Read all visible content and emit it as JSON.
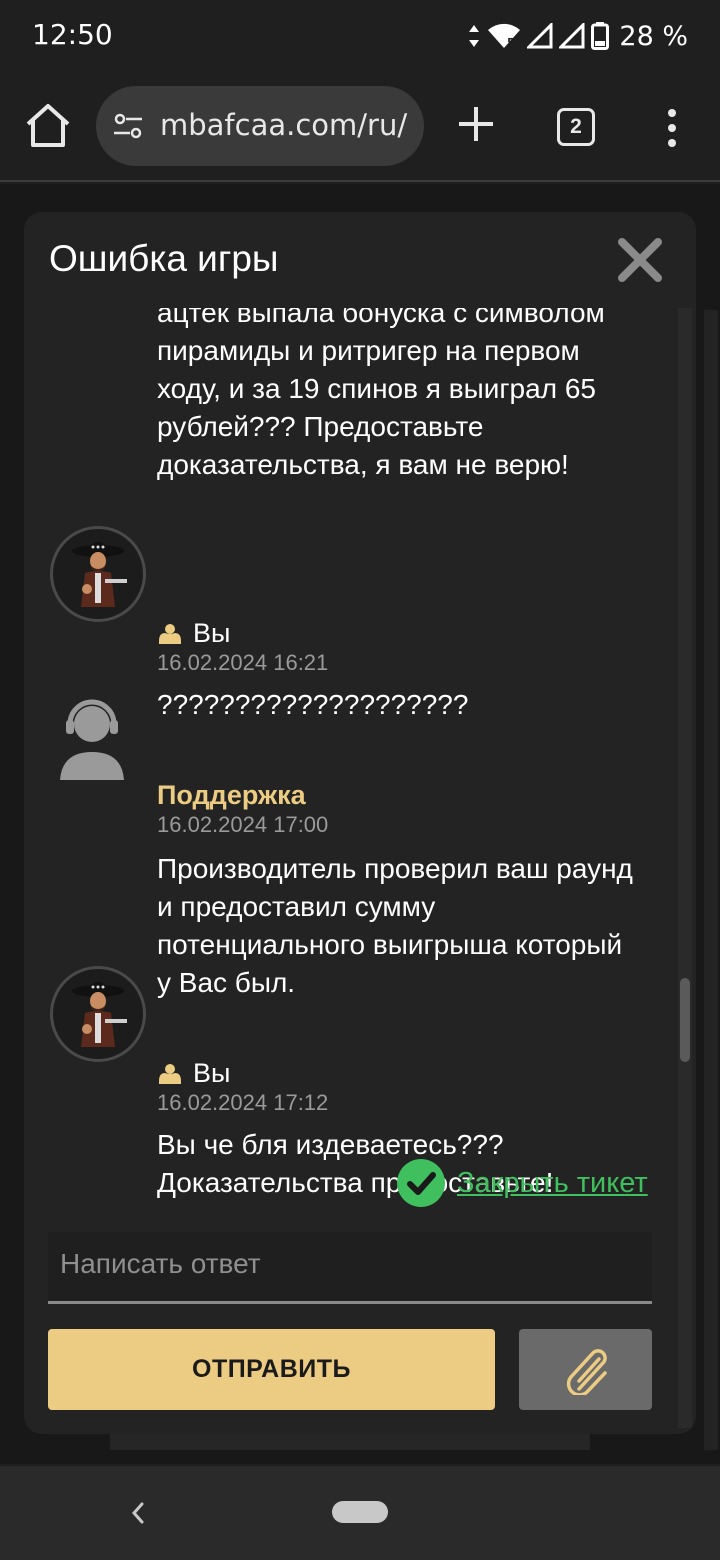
{
  "status_bar": {
    "time": "12:50",
    "battery_text": "28 %",
    "signal_badge": "5"
  },
  "browser": {
    "url": "mbafcaa.com/ru/",
    "tab_count": "2"
  },
  "modal": {
    "title": "Ошибка игры",
    "messages": [
      {
        "lines": [
          "ацтек выпала бонуска с символом",
          "пирамиды и ритригер на первом",
          "ходу, и за 19 спинов я выиграл 65",
          "рублей??? Предоставьте",
          "доказательства, я вам не верю!"
        ]
      },
      {
        "author": "Вы",
        "timestamp": "16.02.2024 16:21",
        "lines": [
          "????????????????????"
        ]
      },
      {
        "author": "Поддержка",
        "timestamp": "16.02.2024 17:00",
        "lines": [
          "Производитель проверил ваш раунд",
          "и предоставил сумму",
          "потенциального выигрыша который",
          "у Вас был."
        ]
      },
      {
        "author": "Вы",
        "timestamp": "16.02.2024 17:12",
        "lines": [
          "Вы че бля издеваетесь???",
          "Доказательства предоставьте!"
        ]
      }
    ],
    "close_ticket_label": "Закрыть тикет",
    "reply_placeholder": "Написать ответ",
    "send_label": "ОТПРАВИТЬ"
  },
  "colors": {
    "accent": "#eccb82",
    "success": "#3fbf5e",
    "background": "#232323"
  }
}
